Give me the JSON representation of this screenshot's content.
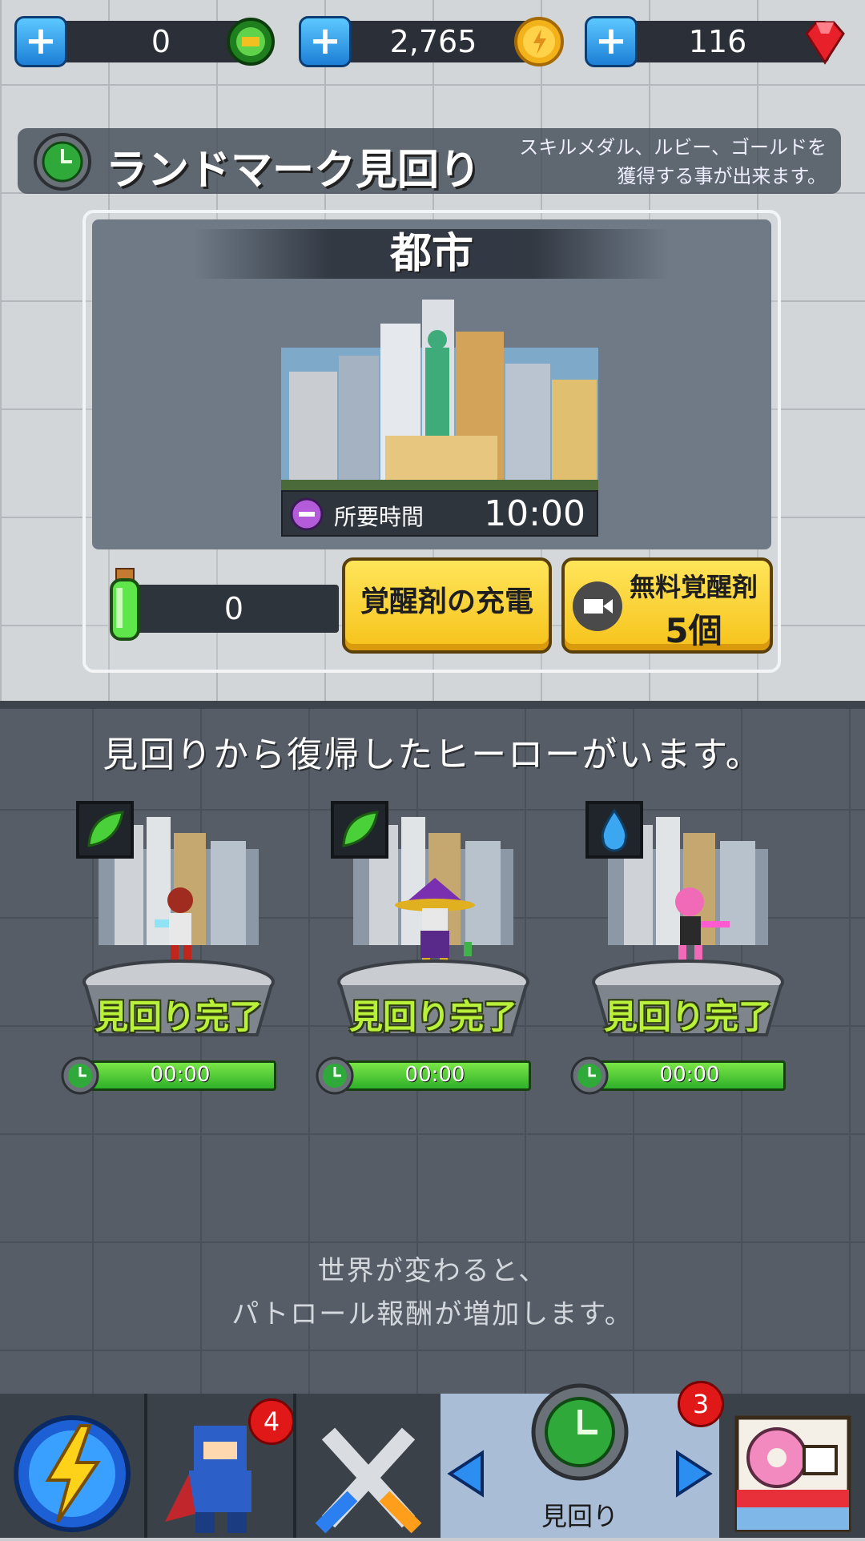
{
  "currencies": [
    {
      "amount": "0",
      "icon": "skill-medal-icon"
    },
    {
      "amount": "2,765",
      "icon": "gold-coin-icon"
    },
    {
      "amount": "116",
      "icon": "ruby-icon"
    }
  ],
  "banner": {
    "title": "ランドマーク見回り",
    "desc_line1": "スキルメダル、ルビー、ゴールドを",
    "desc_line2": "獲得する事が出来ます。"
  },
  "stage": {
    "title": "都市",
    "time_label": "所要時間",
    "time_value": "10:00"
  },
  "potion": {
    "count": "0"
  },
  "buttons": {
    "charge": "覚醒剤の充電",
    "free_line1": "無料覚醒剤",
    "free_line2": "5個"
  },
  "return_message": "見回りから復帰したヒーローがいます。",
  "heroes": [
    {
      "element": "leaf",
      "status": "見回り完了",
      "timer": "00:00"
    },
    {
      "element": "leaf",
      "status": "見回り完了",
      "timer": "00:00"
    },
    {
      "element": "water",
      "status": "見回り完了",
      "timer": "00:00"
    }
  ],
  "world_message": {
    "line1": "世界が変わると、",
    "line2": "パトロール報酬が増加します。"
  },
  "nav": {
    "hero_badge": "4",
    "patrol_badge": "3",
    "patrol_label": "見回り"
  },
  "colors": {
    "accent_yellow": "#f6c21a",
    "timer_green": "#2fb12a",
    "done_text": "#b8f03a",
    "badge_red": "#e01818"
  }
}
